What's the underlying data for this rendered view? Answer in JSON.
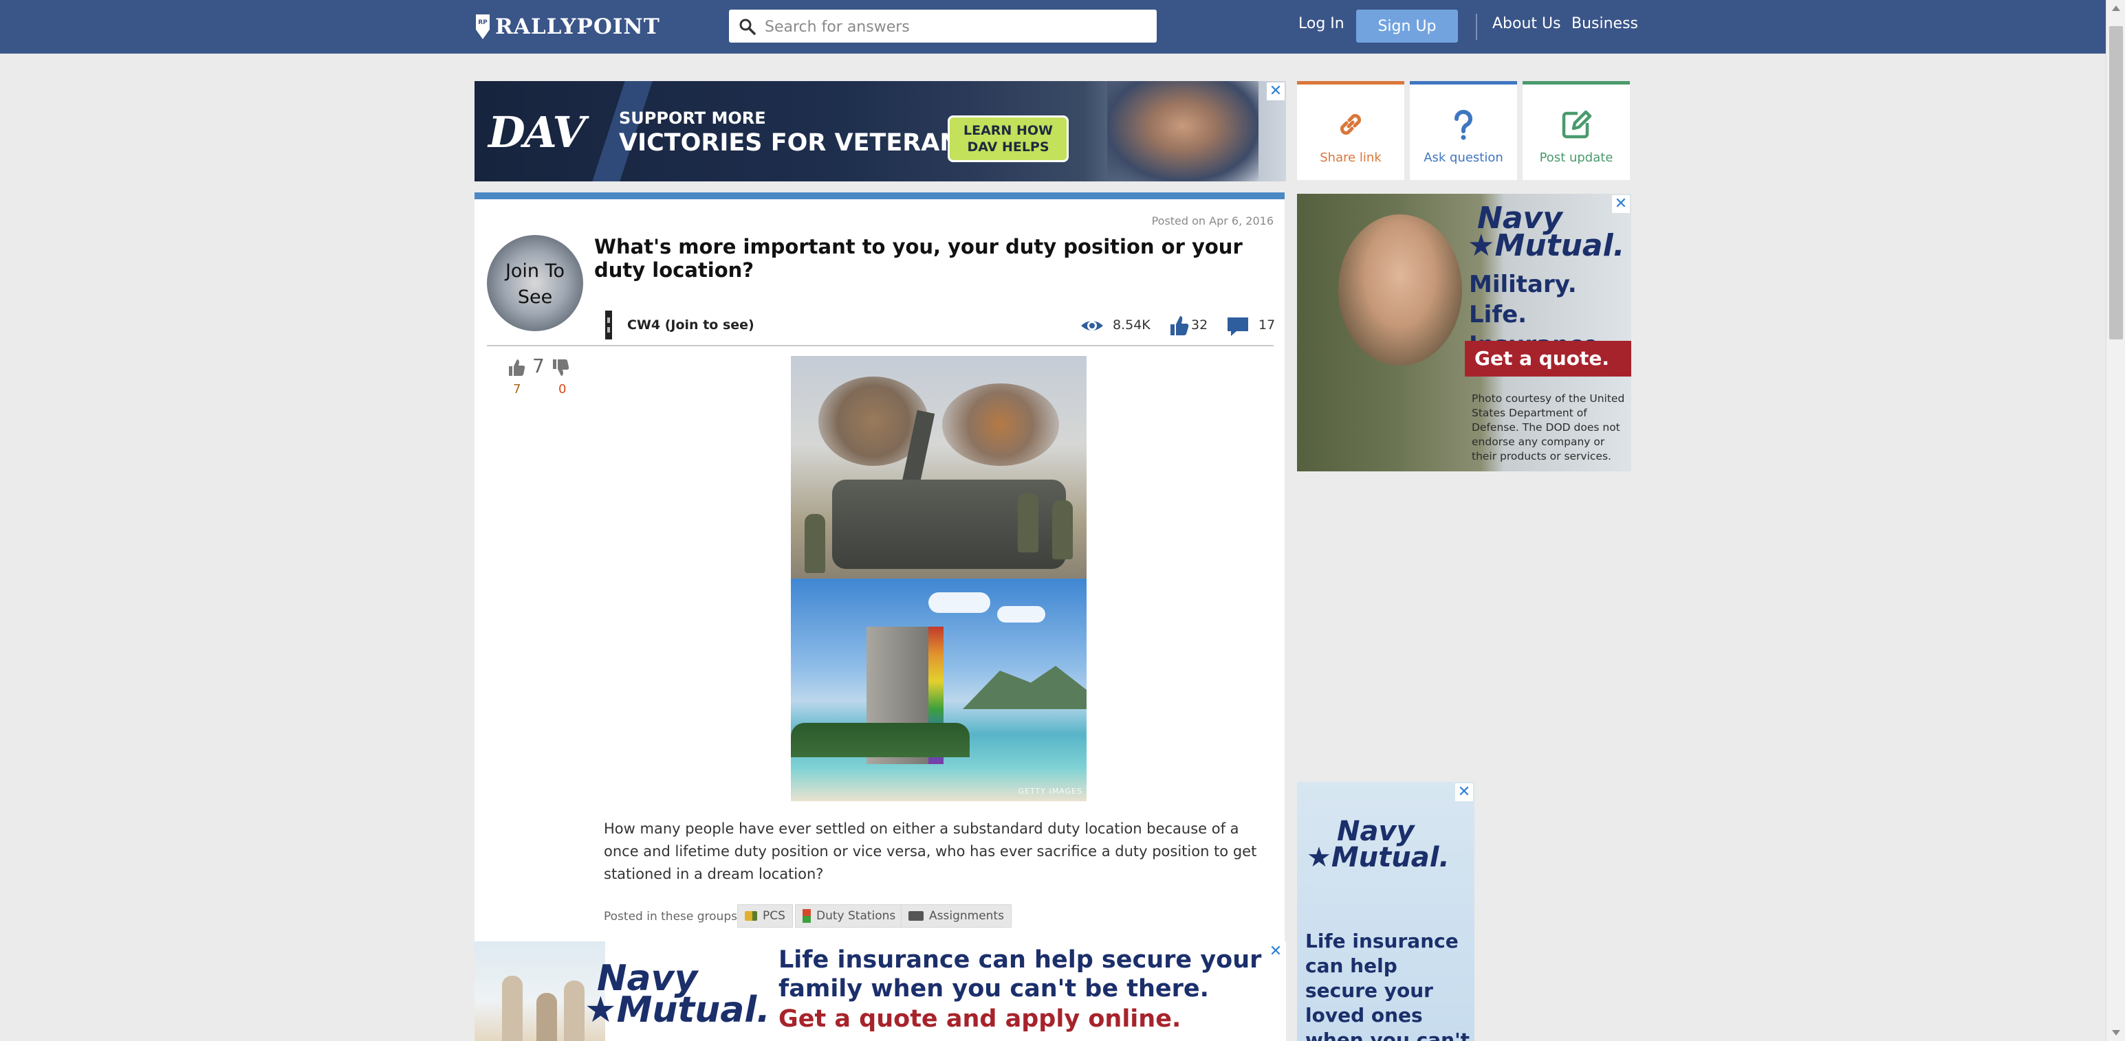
{
  "header": {
    "brand": "RALLYPOINT",
    "search_placeholder": "Search for answers",
    "login": "Log In",
    "signup": "Sign Up",
    "about": "About Us",
    "business": "Business",
    "colors": {
      "bar": "#3a5588",
      "signup": "#72a3df"
    }
  },
  "ads": {
    "dav": {
      "logo": "DAV",
      "line1": "SUPPORT MORE",
      "line2": "VICTORIES FOR VETERANS.",
      "button": "LEARN HOW DAV HELPS"
    },
    "navy_side": {
      "logo_top": "Navy",
      "logo_bottom": "Mutual.",
      "tagline": "Military. Life. Insurance.",
      "cta": "Get a quote.",
      "fineprint": "Photo courtesy of the United States Department of Defense. The DOD does not endorse any company or their products or services."
    },
    "navy_small": {
      "logo_top": "Navy",
      "logo_bottom": "Mutual.",
      "text": "Life insurance can help secure your loved ones when you can't be there."
    },
    "navy_banner": {
      "logo_top": "Navy",
      "logo_bottom": "Mutual.",
      "line1": "Life insurance can help secure your family when you can't be there.",
      "line2": "Get a quote and apply online."
    }
  },
  "actions": [
    {
      "label": "Share link",
      "icon": "link-icon",
      "color": "#d9773a"
    },
    {
      "label": "Ask question",
      "icon": "question-icon",
      "color": "#3f76c0"
    },
    {
      "label": "Post update",
      "icon": "edit-icon",
      "color": "#4a9a6c"
    }
  ],
  "post": {
    "posted_on": "Posted on Apr 6, 2016",
    "avatar_text": "Join To See",
    "title": "What's more important to you, your duty position or your duty location?",
    "author": "CW4 (Join to see)",
    "views": "8.54K",
    "likes": "32",
    "comments": "17",
    "vote_score": "7",
    "upvotes": "7",
    "downvotes": "0",
    "image_credit": "GETTY IMAGES",
    "body": "How many people have ever settled on either a substandard duty location because of a once and lifetime duty position or vice versa, who has ever sacrifice a duty position to get stationed in a dream location?",
    "groups_label": "Posted in these groups:",
    "groups": [
      "PCS",
      "Duty Stations",
      "Assignments"
    ],
    "accent": "#4b89c4"
  }
}
